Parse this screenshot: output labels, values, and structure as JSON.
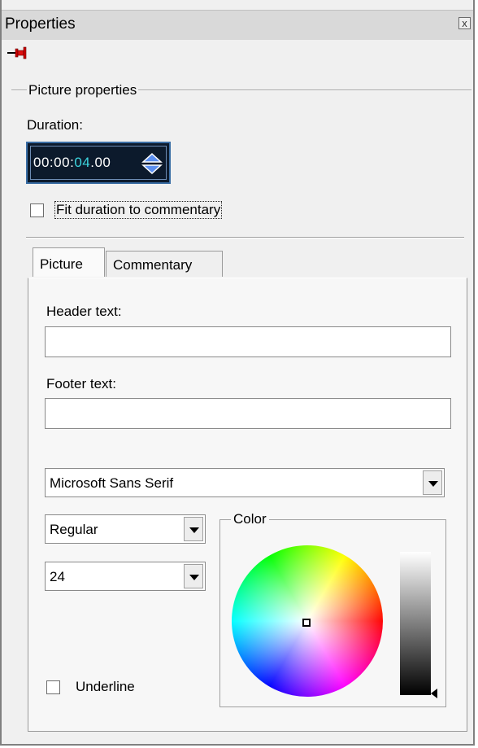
{
  "window": {
    "title": "Properties",
    "close_glyph": "x"
  },
  "pin": {
    "icon": "pushpin-icon",
    "color": "#cc0000"
  },
  "picture_properties": {
    "group_label": "Picture properties",
    "duration_label": "Duration:",
    "duration": {
      "hh": "00",
      "mm": "00",
      "ss": "04",
      "ff": "00",
      "sep1": ":",
      "sep2": ":",
      "sep3": ".",
      "highlight_color": "#3dd6e0"
    },
    "fit_checkbox": {
      "label": "Fit duration to commentary",
      "checked": false
    }
  },
  "tabs": [
    {
      "label": "Picture",
      "active": true
    },
    {
      "label": "Commentary",
      "active": false
    }
  ],
  "picture_tab": {
    "header_label": "Header text:",
    "header_value": "",
    "footer_label": "Footer text:",
    "footer_value": "",
    "font": {
      "family": "Microsoft Sans Serif",
      "style": "Regular",
      "size": "24"
    },
    "underline": {
      "label": "Underline",
      "checked": false
    },
    "color_label": "Color"
  }
}
